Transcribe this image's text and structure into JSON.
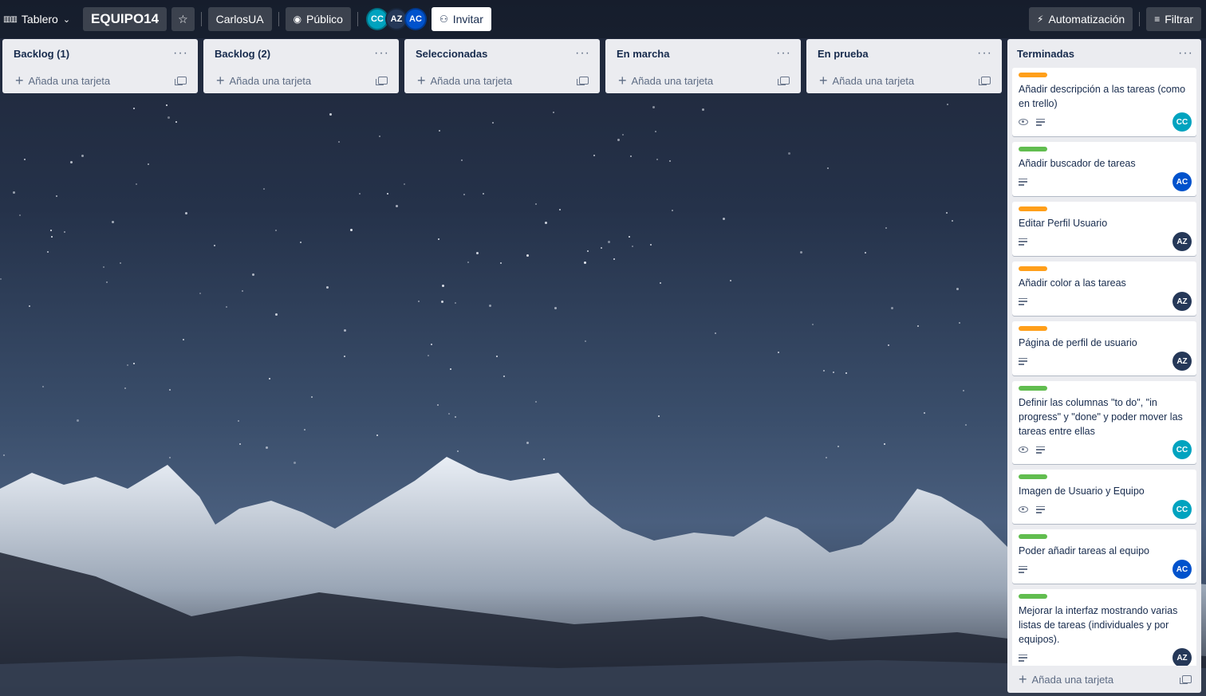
{
  "topbar": {
    "view_label": "Tablero",
    "board_title": "EQUIPO14",
    "workspace": "CarlosUA",
    "visibility": "Público",
    "invite_label": "Invitar",
    "automation_label": "Automatización",
    "filter_label": "Filtrar",
    "members": [
      {
        "initials": "CC",
        "color": "#00a3bf"
      },
      {
        "initials": "AZ",
        "color": "#253858"
      },
      {
        "initials": "AC",
        "color": "#0052cc"
      }
    ]
  },
  "add_card_label": "Añada una tarjeta",
  "lists": [
    {
      "title": "Backlog (1)"
    },
    {
      "title": "Backlog (2)"
    },
    {
      "title": "Seleccionadas"
    },
    {
      "title": "En marcha"
    },
    {
      "title": "En prueba"
    }
  ],
  "done_list": {
    "title": "Terminadas",
    "cards": [
      {
        "label_color": "#ff9f1a",
        "text": "Añadir descripción a las tareas (como en trello)",
        "watch": true,
        "description": true,
        "member": "CC",
        "member_color": "#00a3bf"
      },
      {
        "label_color": "#61bd4f",
        "text": "Añadir buscador de tareas",
        "watch": false,
        "description": true,
        "member": "AC",
        "member_color": "#0052cc"
      },
      {
        "label_color": "#ff9f1a",
        "text": "Editar Perfil Usuario",
        "watch": false,
        "description": true,
        "member": "AZ",
        "member_color": "#253858"
      },
      {
        "label_color": "#ff9f1a",
        "text": "Añadir color a las tareas",
        "watch": false,
        "description": true,
        "member": "AZ",
        "member_color": "#253858"
      },
      {
        "label_color": "#ff9f1a",
        "text": "Página de perfil de usuario",
        "watch": false,
        "description": true,
        "member": "AZ",
        "member_color": "#253858"
      },
      {
        "label_color": "#61bd4f",
        "text": "Definir las columnas \"to do\", \"in progress\" y \"done\" y poder mover las tareas entre ellas",
        "watch": true,
        "description": true,
        "member": "CC",
        "member_color": "#00a3bf"
      },
      {
        "label_color": "#61bd4f",
        "text": "Imagen de Usuario y Equipo",
        "watch": true,
        "description": true,
        "member": "CC",
        "member_color": "#00a3bf"
      },
      {
        "label_color": "#61bd4f",
        "text": "Poder añadir tareas al equipo",
        "watch": false,
        "description": true,
        "member": "AC",
        "member_color": "#0052cc"
      },
      {
        "label_color": "#61bd4f",
        "text": "Mejorar la interfaz mostrando varias listas de tareas (individuales y por equipos).",
        "watch": false,
        "description": true,
        "member": "AZ",
        "member_color": "#253858"
      }
    ]
  }
}
